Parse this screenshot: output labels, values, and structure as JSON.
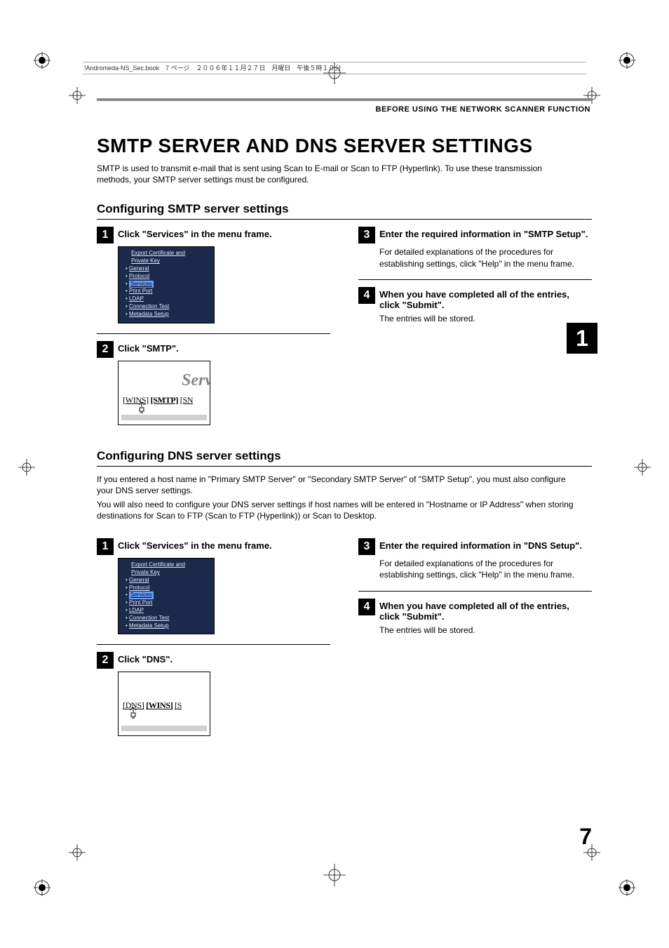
{
  "running_head": "!Andromeda-NS_Sec.book　7 ページ　２００６年１１月２７日　月曜日　午後５時１０分",
  "header_section": "BEFORE USING THE NETWORK SCANNER FUNCTION",
  "title": "SMTP SERVER AND DNS SERVER SETTINGS",
  "intro": "SMTP is used to transmit e-mail that is sent using Scan to E-mail or Scan to FTP (Hyperlink). To use these transmission methods, your SMTP server settings must be configured.",
  "chapter_tab": "1",
  "page_number": "7",
  "smtp": {
    "heading": "Configuring SMTP server settings",
    "s1_title": "Click \"Services\" in the menu frame.",
    "s2_title": "Click \"SMTP\".",
    "s3_title": "Enter the required information in \"SMTP Setup\".",
    "s3_body": "For detailed explanations of the procedures for establishing settings, click \"Help\" in the menu frame.",
    "s4_title": "When you have completed all of the entries, click \"Submit\".",
    "s4_body": "The entries will be stored.",
    "crop_big": "Serv",
    "crop_links": [
      "[WINS]",
      "[SMTP]",
      "[SN"
    ]
  },
  "dns": {
    "heading": "Configuring DNS server settings",
    "intro1": "If you entered a host name in \"Primary SMTP Server\" or \"Secondary SMTP Server\" of \"SMTP Setup\", you must also configure your DNS server settings.",
    "intro2": "You will also need to configure your DNS server settings if host names will be entered in \"Hostname or IP Address\" when storing destinations for Scan to FTP (Scan to FTP (Hyperlink)) or Scan to Desktop.",
    "s1_title": "Click \"Services\" in the menu frame.",
    "s2_title": "Click \"DNS\".",
    "s3_title": "Enter the required information in \"DNS Setup\".",
    "s3_body": "For detailed explanations of the procedures for establishing settings, click \"Help\" in the menu frame.",
    "s4_title": "When you have completed all of the entries, click \"Submit\".",
    "s4_body": "The entries will be stored.",
    "crop_links": [
      "[DNS]",
      "[WINS]",
      "[S"
    ]
  },
  "menu": {
    "items": [
      "Export Certificate and",
      "Private Key",
      "General",
      "Protocol",
      "Services",
      "Print Port",
      "LDAP",
      "Connection Test",
      "Metadata Setup"
    ]
  }
}
